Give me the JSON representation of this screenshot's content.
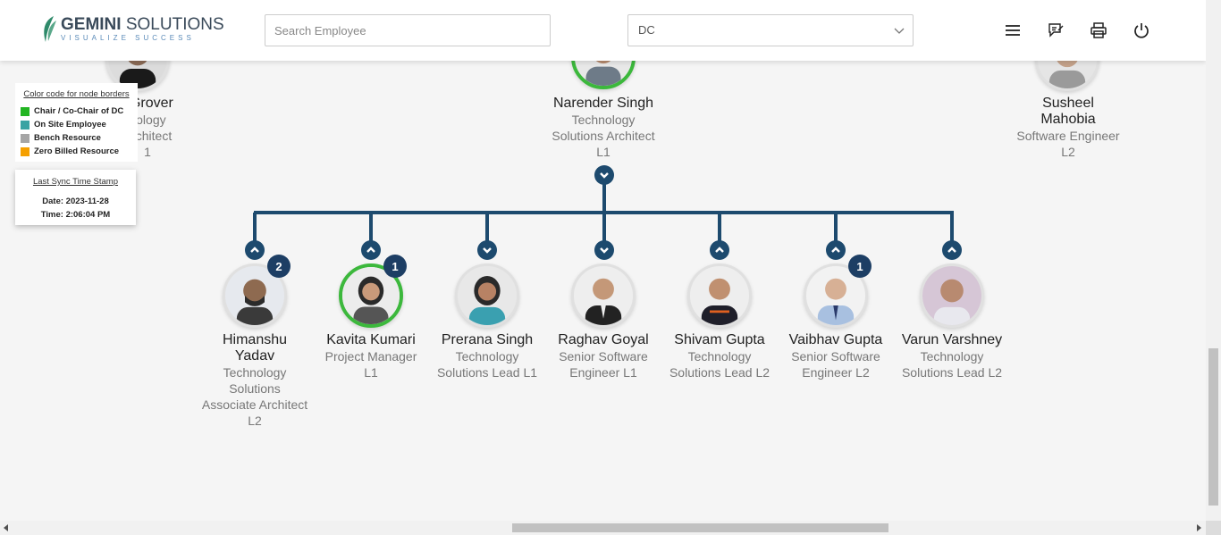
{
  "header": {
    "logo_title_bold": "GEMINI",
    "logo_title_rest": "SOLUTIONS",
    "logo_subtitle": "VISUALIZE SUCCESS",
    "search_placeholder": "Search Employee",
    "dept_select_value": "DC",
    "icons": [
      "menu-icon",
      "feedback-icon",
      "print-icon",
      "power-icon"
    ]
  },
  "legend": {
    "title": "Color code for node borders",
    "items": [
      {
        "label": "Chair / Co-Chair of DC",
        "color": "#22b522"
      },
      {
        "label": "On Site Employee",
        "color": "#3aa3a3"
      },
      {
        "label": "Bench Resource",
        "color": "#a6a6a6"
      },
      {
        "label": "Zero Billed Resource",
        "color": "#f5a000"
      }
    ]
  },
  "sync": {
    "title": "Last Sync Time Stamp",
    "date_line": "Date: 2023-11-28",
    "time_line": "Time: 2:06:04 PM"
  },
  "top_row": [
    {
      "name": ": Grover",
      "role_lines": [
        "nology",
        "Architect",
        "1"
      ]
    },
    {
      "name": "Narender Singh",
      "role_lines": [
        "Technology",
        "Solutions Architect",
        "L1"
      ]
    },
    {
      "name_lines": [
        "Susheel",
        "Mahobia"
      ],
      "role_lines": [
        "Software Engineer",
        "L2"
      ]
    }
  ],
  "children": [
    {
      "name_lines": [
        "Himanshu",
        "Yadav"
      ],
      "role_lines": [
        "Technology",
        "Solutions",
        "Associate Architect",
        "L2"
      ],
      "badge": "2"
    },
    {
      "name_lines": [
        "Kavita Kumari"
      ],
      "role_lines": [
        "Project Manager",
        "L1"
      ],
      "badge": "1"
    },
    {
      "name_lines": [
        "Prerana Singh"
      ],
      "role_lines": [
        "Technology",
        "Solutions Lead L1"
      ]
    },
    {
      "name_lines": [
        "Raghav Goyal"
      ],
      "role_lines": [
        "Senior Software",
        "Engineer L1"
      ]
    },
    {
      "name_lines": [
        "Shivam Gupta"
      ],
      "role_lines": [
        "Technology",
        "Solutions Lead L2"
      ]
    },
    {
      "name_lines": [
        "Vaibhav Gupta"
      ],
      "role_lines": [
        "Senior Software",
        "Engineer L2"
      ],
      "badge": "1"
    },
    {
      "name_lines": [
        "Varun Varshney"
      ],
      "role_lines": [
        "Technology",
        "Solutions Lead L2"
      ]
    }
  ],
  "colors": {
    "connector": "#1d4a6e",
    "badge": "#1d3e64",
    "chair_border": "#3cb83c"
  }
}
